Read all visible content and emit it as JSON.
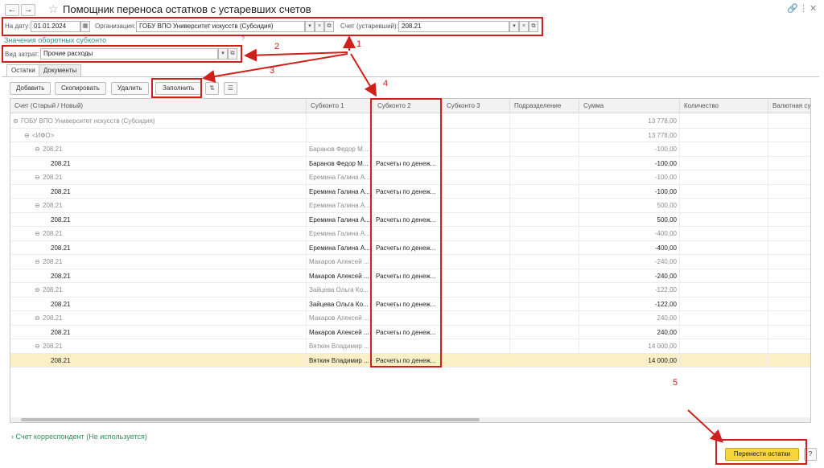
{
  "window": {
    "title": "Помощник переноса остатков с устаревших счетов",
    "back_icon": "arrow-left",
    "forward_icon": "arrow-right"
  },
  "header": {
    "date_label": "На дату:",
    "date_value": "01.01.2024",
    "org_label": "Организация:",
    "org_value": "ГОБУ ВПО Университет искусств (Субсидия)",
    "account_label": "Счет (устаревший):",
    "account_value": "208.21",
    "subconto_link": "Значения оборотных субконто",
    "help_mark": "?",
    "cost_label": "Вид затрат:",
    "cost_value": "Прочие расходы"
  },
  "tabs": [
    {
      "label": "Остатки",
      "active": true
    },
    {
      "label": "Документы",
      "active": false
    }
  ],
  "toolbar": {
    "add": "Добавить",
    "copy": "Скопировать",
    "delete": "Удалить",
    "fill": "Заполнить"
  },
  "table": {
    "columns": [
      "Счет (Старый / Новый)",
      "Субконто 1",
      "Субконто 2",
      "Субконто 3",
      "Подразделение",
      "Сумма",
      "Количество",
      "Валютная сумма"
    ],
    "rows": [
      {
        "level": 0,
        "group": true,
        "account": "ГОБУ ВПО Университет искусств (Субсидия)",
        "sub1": "",
        "sub2": "",
        "sum": "13 778,00"
      },
      {
        "level": 1,
        "group": true,
        "account": "<ИФО>",
        "sub1": "",
        "sub2": "",
        "sum": "13 778,00"
      },
      {
        "level": 2,
        "group": true,
        "account": "208.21",
        "sub1": "Баранов Федор М...",
        "sub2": "",
        "sum": "-100,00"
      },
      {
        "level": 3,
        "group": false,
        "account": "208.21",
        "sub1": "Баранов Федор М...",
        "sub2": "Расчеты по денеж...",
        "sum": "-100,00"
      },
      {
        "level": 2,
        "group": true,
        "account": "208.21",
        "sub1": "Еремина Галина А...",
        "sub2": "",
        "sum": "-100,00"
      },
      {
        "level": 3,
        "group": false,
        "account": "208.21",
        "sub1": "Еремина Галина А...",
        "sub2": "Расчеты по денеж...",
        "sum": "-100,00"
      },
      {
        "level": 2,
        "group": true,
        "account": "208.21",
        "sub1": "Еремина Галина А...",
        "sub2": "",
        "sum": "500,00"
      },
      {
        "level": 3,
        "group": false,
        "account": "208.21",
        "sub1": "Еремина Галина А...",
        "sub2": "Расчеты по денеж...",
        "sum": "500,00"
      },
      {
        "level": 2,
        "group": true,
        "account": "208.21",
        "sub1": "Еремина Галина А...",
        "sub2": "",
        "sum": "-400,00"
      },
      {
        "level": 3,
        "group": false,
        "account": "208.21",
        "sub1": "Еремина Галина А...",
        "sub2": "Расчеты по денеж...",
        "sum": "-400,00"
      },
      {
        "level": 2,
        "group": true,
        "account": "208.21",
        "sub1": "Макаров Алексей ...",
        "sub2": "",
        "sum": "-240,00"
      },
      {
        "level": 3,
        "group": false,
        "account": "208.21",
        "sub1": "Макаров Алексей ...",
        "sub2": "Расчеты по денеж...",
        "sum": "-240,00"
      },
      {
        "level": 2,
        "group": true,
        "account": "208.21",
        "sub1": "Зайцева Ольга Ко...",
        "sub2": "",
        "sum": "-122,00"
      },
      {
        "level": 3,
        "group": false,
        "account": "208.21",
        "sub1": "Зайцева Ольга Ко...",
        "sub2": "Расчеты по денеж...",
        "sum": "-122,00"
      },
      {
        "level": 2,
        "group": true,
        "account": "208.21",
        "sub1": "Макаров Алексей ...",
        "sub2": "",
        "sum": "240,00"
      },
      {
        "level": 3,
        "group": false,
        "account": "208.21",
        "sub1": "Макаров Алексей ...",
        "sub2": "Расчеты по денеж...",
        "sum": "240,00"
      },
      {
        "level": 2,
        "group": true,
        "account": "208.21",
        "sub1": "Вяткин Владимир ...",
        "sub2": "",
        "sum": "14 000,00"
      },
      {
        "level": 3,
        "group": false,
        "account": "208.21",
        "sub1": "Вяткин Владимир ...",
        "sub2": "Расчеты по денеж...",
        "sum": "14 000,00",
        "selected": true
      }
    ]
  },
  "footer": {
    "correspondent_link": "Счет корреспондент (Не используется)",
    "transfer_button": "Перенести остатки",
    "help_button": "?"
  },
  "annotations": {
    "n1": "1",
    "n2": "2",
    "n3": "3",
    "n4": "4",
    "n5": "5",
    "color": "#d0201c"
  },
  "colors": {
    "accent_button": "#f6d63a",
    "selected_row": "#fbf0c5",
    "link_green": "#2f8f57"
  }
}
